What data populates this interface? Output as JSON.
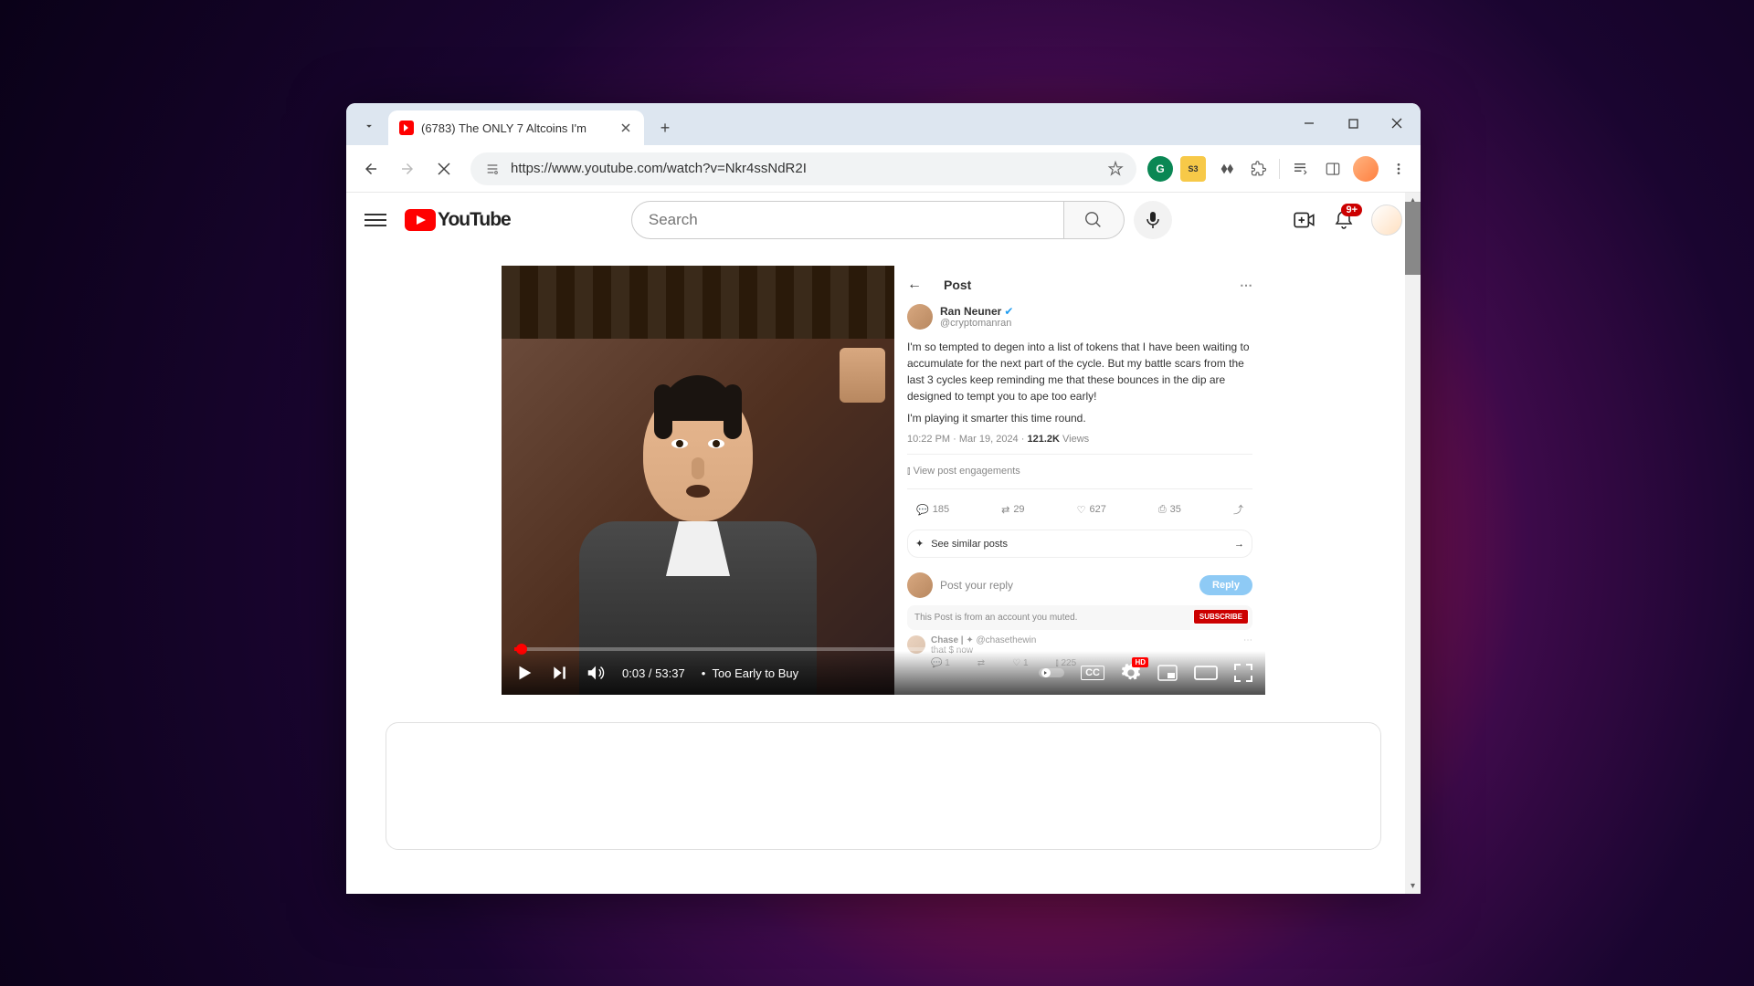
{
  "browser": {
    "tab_title": "(6783) The ONLY 7 Altcoins I'm",
    "url": "https://www.youtube.com/watch?v=Nkr4ssNdR2I"
  },
  "youtube": {
    "logo_text": "YouTube",
    "search_placeholder": "Search",
    "notification_count": "9+"
  },
  "video": {
    "current_time": "0:03",
    "duration": "53:37",
    "chapter_separator": "•",
    "chapter": "Too Early to Buy",
    "cc_label": "CC",
    "hd_label": "HD"
  },
  "tweet": {
    "header": "Post",
    "author_name": "Ran Neuner",
    "author_handle": "@cryptomanran",
    "body1": "I'm so tempted to degen into a list of tokens that I have been waiting to accumulate for the next part of the cycle. But my battle scars from the last 3 cycles keep reminding me that these bounces in the dip are designed to tempt you to ape too early!",
    "body2": "I'm playing it smarter this time round.",
    "timestamp": "10:22 PM · Mar 19, 2024",
    "views_count": "121.2K",
    "views_label": "Views",
    "engagements": "View post engagements",
    "replies": "185",
    "retweets": "29",
    "likes": "627",
    "bookmarks": "35",
    "similar": "See similar posts",
    "reply_placeholder": "Post your reply",
    "reply_btn": "Reply",
    "muted_text": "This Post is from an account you muted.",
    "subscribe": "SUBSCRIBE",
    "reply_author": "Chase |",
    "reply_handle": "@chasethewin",
    "reply_snippet": "that $ now",
    "reply_like": "1",
    "reply_views": "225"
  }
}
